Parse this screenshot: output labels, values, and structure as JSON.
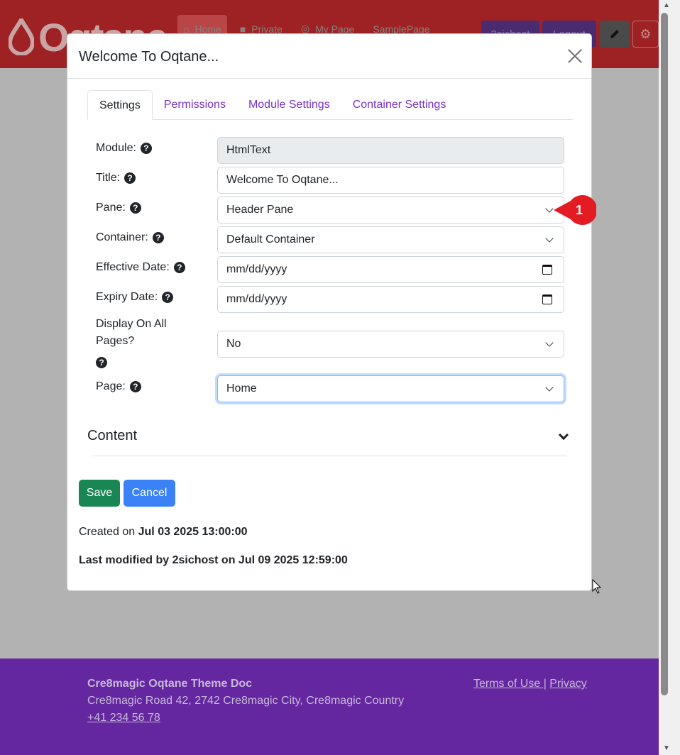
{
  "header": {
    "logo_text": "Oqtane",
    "nav": [
      {
        "label": "Home"
      },
      {
        "label": "Private"
      },
      {
        "label": "My Page"
      },
      {
        "label": "SamplePage"
      }
    ],
    "user_button": "2sichost",
    "logout_button": "Logout"
  },
  "modal": {
    "title": "Welcome To Oqtane...",
    "tabs": [
      {
        "label": "Settings"
      },
      {
        "label": "Permissions"
      },
      {
        "label": "Module Settings"
      },
      {
        "label": "Container Settings"
      }
    ],
    "fields": {
      "module": {
        "label": "Module:",
        "value": "HtmlText"
      },
      "title": {
        "label": "Title:",
        "value": "Welcome To Oqtane..."
      },
      "pane": {
        "label": "Pane:",
        "value": "Header Pane"
      },
      "container": {
        "label": "Container:",
        "value": "Default Container"
      },
      "effective_date": {
        "label": "Effective Date:",
        "value": "mm/dd/yyyy"
      },
      "expiry_date": {
        "label": "Expiry Date:",
        "value": "mm/dd/yyyy"
      },
      "display_all": {
        "label_line1": "Display On All",
        "label_line2": "Pages?",
        "value": "No"
      },
      "page": {
        "label": "Page:",
        "value": "Home"
      }
    },
    "content_heading": "Content",
    "save_label": "Save",
    "cancel_label": "Cancel",
    "created_prefix": "Created on",
    "created_date": "Jul 03 2025 13:00:00",
    "modified_text": "Last modified by 2sichost on Jul 09 2025 12:59:00"
  },
  "footer": {
    "title": "Cre8magic Oqtane Theme Doc",
    "address": "Cre8magic Road 42, 2742 Cre8magic City, Cre8magic Country",
    "phone": "+41 234 56 78",
    "terms": "Terms of Use |",
    "privacy": "Privacy"
  },
  "annotation": {
    "number": "1"
  },
  "colors": {
    "header_bg": "#9e2223",
    "footer_bg": "#65279f",
    "tab_link": "#7b32c9",
    "save": "#198754",
    "cancel": "#3b82f6",
    "badge": "#e31b23"
  }
}
